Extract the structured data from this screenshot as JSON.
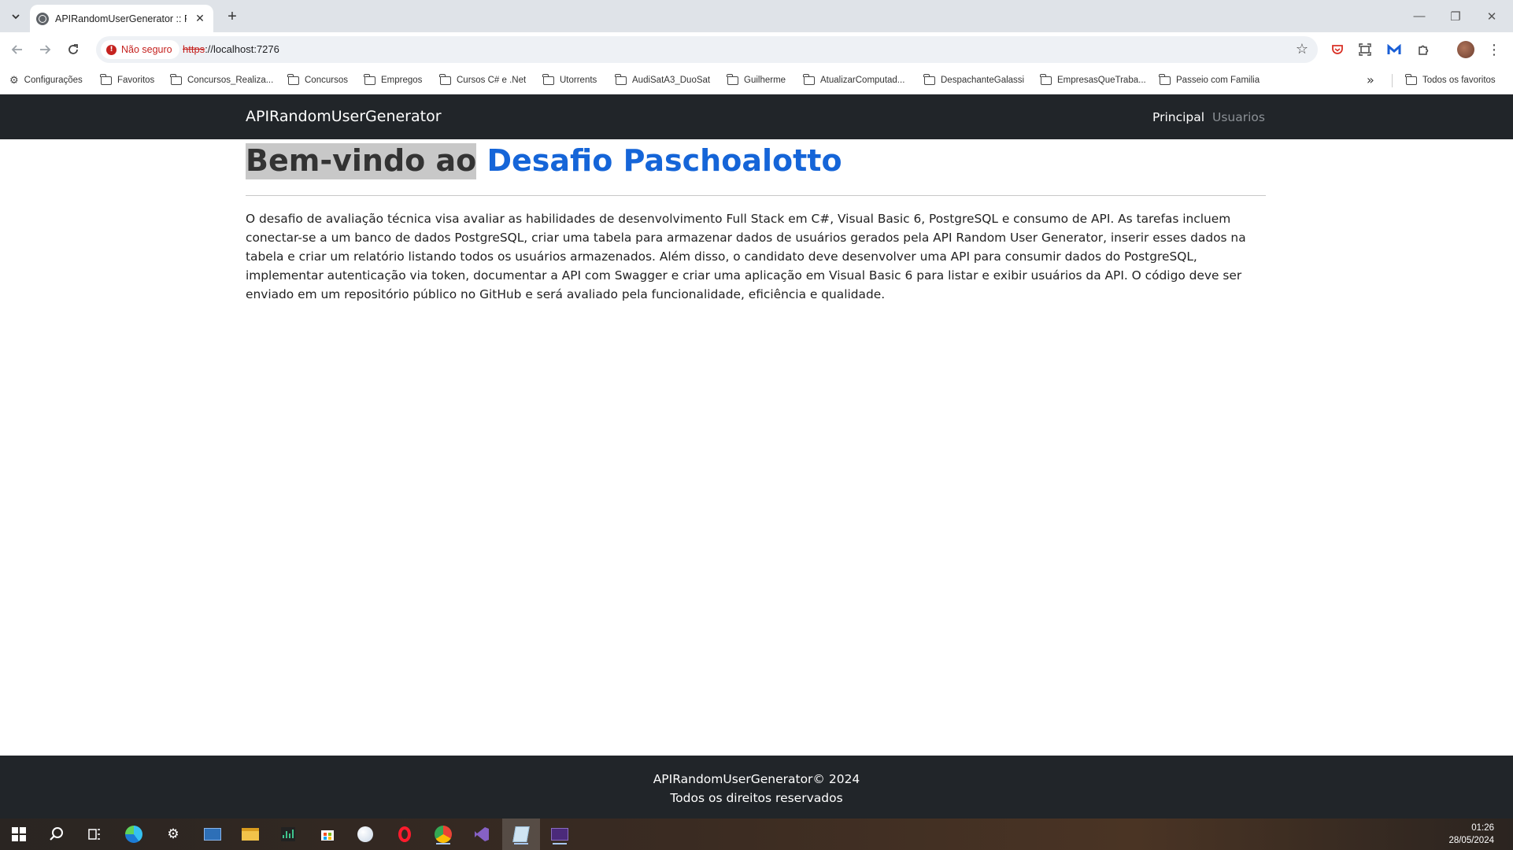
{
  "browser": {
    "tab": {
      "title": "APIRandomUserGenerator :: Pá",
      "close_glyph": "✕"
    },
    "new_tab_glyph": "+",
    "window_controls": {
      "minimize": "—",
      "restore": "❐",
      "close": "✕"
    },
    "security_label": "Não seguro",
    "url": {
      "scheme": "https",
      "rest": "://localhost:7276"
    },
    "bookmarks": [
      {
        "label": "Configurações",
        "icon": "gear-icon"
      },
      {
        "label": "Favoritos",
        "icon": "folder-icon"
      },
      {
        "label": "Concursos_Realiza...",
        "icon": "folder-icon"
      },
      {
        "label": "Concursos",
        "icon": "folder-icon"
      },
      {
        "label": "Empregos",
        "icon": "folder-icon"
      },
      {
        "label": "Cursos C# e .Net",
        "icon": "folder-icon"
      },
      {
        "label": "Utorrents",
        "icon": "folder-icon"
      },
      {
        "label": "AudiSatA3_DuoSat",
        "icon": "folder-icon"
      },
      {
        "label": "Guilherme",
        "icon": "folder-icon"
      },
      {
        "label": "AtualizarComputad...",
        "icon": "folder-icon"
      },
      {
        "label": "DespachanteGalassi",
        "icon": "folder-icon"
      },
      {
        "label": "EmpresasQueTraba...",
        "icon": "folder-icon"
      },
      {
        "label": "Passeio com Familia",
        "icon": "folder-icon"
      }
    ],
    "all_bookmarks_label": "Todos os favoritos"
  },
  "app": {
    "brand": "APIRandomUserGenerator",
    "nav": {
      "home": "Principal",
      "users": "Usuarios"
    },
    "hero": {
      "prefix": "Bem-vindo ao",
      "highlight": "Desafio Paschoalotto"
    },
    "intro": "O desafio de avaliação técnica visa avaliar as habilidades de desenvolvimento Full Stack em C#, Visual Basic 6, PostgreSQL e consumo de API. As tarefas incluem conectar-se a um banco de dados PostgreSQL, criar uma tabela para armazenar dados de usuários gerados pela API Random User Generator, inserir esses dados na tabela e criar um relatório listando todos os usuários armazenados. Além disso, o candidato deve desenvolver uma API para consumir dados do PostgreSQL, implementar autenticação via token, documentar a API com Swagger e criar uma aplicação em Visual Basic 6 para listar e exibir usuários da API. O código deve ser enviado em um repositório público no GitHub e será avaliado pela funcionalidade, eficiência e qualidade.",
    "footer": {
      "line1": "APIRandomUserGenerator© 2024",
      "line2": "Todos os direitos reservados"
    }
  },
  "taskbar": {
    "time": "01:26",
    "date": "28/05/2024"
  },
  "colors": {
    "navbar": "#212529",
    "accent": "#1565d8",
    "warning": "#c5221f"
  }
}
